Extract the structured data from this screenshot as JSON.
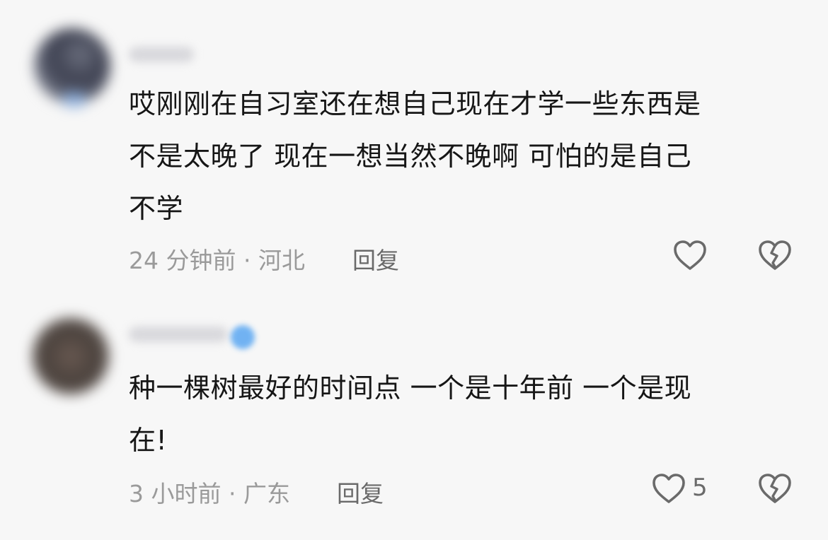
{
  "comments": [
    {
      "text_lines": [
        "哎刚刚在自习室还在想自己现在才学一些东西是",
        "不是太晚了 现在一想当然不晚啊 可怕的是自己",
        "不学"
      ],
      "time_location": "24 分钟前 · 河北",
      "reply_label": "回复",
      "like_icon": "heart-outline-icon",
      "dislike_icon": "broken-heart-icon"
    },
    {
      "text_lines": [
        "种一棵树最好的时间点 一个是十年前 一个是现",
        "在!"
      ],
      "time_location": "3 小时前 · 广东",
      "reply_label": "回复",
      "like_count": "5",
      "like_icon": "heart-outline-icon",
      "dislike_icon": "broken-heart-icon"
    }
  ],
  "colors": {
    "background": "#f7f7f7",
    "text": "#161616",
    "meta": "#9a9a9a",
    "icon": "#6a6a6a",
    "verified": "#5aa7f2"
  }
}
